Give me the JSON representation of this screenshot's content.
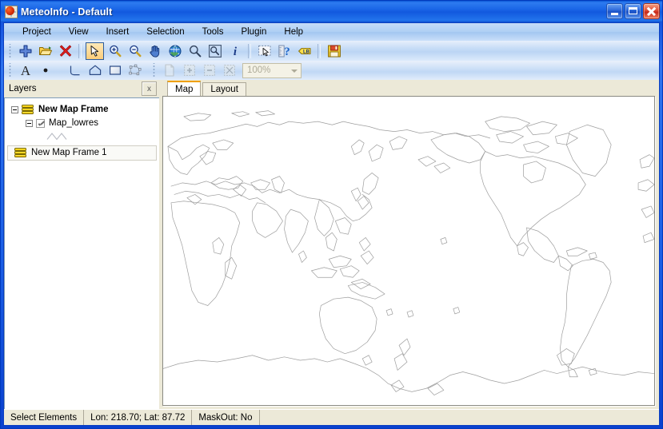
{
  "window": {
    "title": "MeteoInfo - Default",
    "app_icon": "meteoinfo-icon",
    "minimize_label": "Minimize",
    "maximize_label": "Maximize",
    "close_label": "Close"
  },
  "menubar": {
    "items": [
      {
        "label": "Project"
      },
      {
        "label": "View"
      },
      {
        "label": "Insert"
      },
      {
        "label": "Selection"
      },
      {
        "label": "Tools"
      },
      {
        "label": "Plugin"
      },
      {
        "label": "Help"
      }
    ]
  },
  "toolbar_main": {
    "buttons": [
      {
        "name": "add-layer-icon",
        "title": "Add Layer"
      },
      {
        "name": "open-project-icon",
        "title": "Open Project"
      },
      {
        "name": "remove-layer-icon",
        "title": "Remove Layer"
      },
      {
        "name": "select-elements-icon",
        "title": "Select Elements",
        "selected": true
      },
      {
        "name": "zoom-in-icon",
        "title": "Zoom In"
      },
      {
        "name": "zoom-out-icon",
        "title": "Zoom Out"
      },
      {
        "name": "pan-icon",
        "title": "Pan"
      },
      {
        "name": "full-extent-icon",
        "title": "Full Extent"
      },
      {
        "name": "identify-icon",
        "title": "Identify"
      },
      {
        "name": "select-features-icon",
        "title": "Select Features"
      },
      {
        "name": "info-icon",
        "title": "Information"
      },
      {
        "name": "select-by-rectangle-icon",
        "title": "Select By Rectangle"
      },
      {
        "name": "measurement-icon",
        "title": "Measurement"
      },
      {
        "name": "label-set-icon",
        "title": "Label Set"
      },
      {
        "name": "save-project-icon",
        "title": "Save Project"
      }
    ]
  },
  "toolbar_draw": {
    "buttons": [
      {
        "name": "text-tool-icon",
        "title": "New Label"
      },
      {
        "name": "point-tool-icon",
        "title": "New Point"
      },
      {
        "name": "polyline-tool-icon",
        "title": "New Polyline"
      },
      {
        "name": "polygon-tool-icon",
        "title": "New Polygon"
      },
      {
        "name": "rectangle-tool-icon",
        "title": "New Rectangle"
      },
      {
        "name": "freehand-polygon-tool-icon",
        "title": "New Freehand Polygon"
      },
      {
        "name": "new-page-icon",
        "title": "New Page",
        "disabled": true
      },
      {
        "name": "page-zoom-in-icon",
        "title": "Page Zoom In",
        "disabled": true
      },
      {
        "name": "page-zoom-out-icon",
        "title": "Page Zoom Out",
        "disabled": true
      },
      {
        "name": "page-zoom-fit-icon",
        "title": "Zoom To Page",
        "disabled": true
      }
    ],
    "zoom_value": "100%"
  },
  "layers_panel": {
    "title": "Layers",
    "close_label": "x",
    "tree": {
      "root_label": "New Map Frame",
      "layer_label": "Map_lowres",
      "layer_checked": true,
      "symbol_name": "polyline-symbol"
    },
    "other_frame_label": "New Map Frame 1"
  },
  "view_tabs": [
    {
      "label": "Map",
      "active": true
    },
    {
      "label": "Layout",
      "active": false
    }
  ],
  "map": {
    "background_color": "#FFFFFF",
    "outline_color": "#9E9E9E",
    "projection_note": "Pacific-centred world coastlines"
  },
  "statusbar": {
    "mode": "Select Elements",
    "coordinates": "Lon: 218.70; Lat: 87.72",
    "maskout": "MaskOut: No"
  }
}
